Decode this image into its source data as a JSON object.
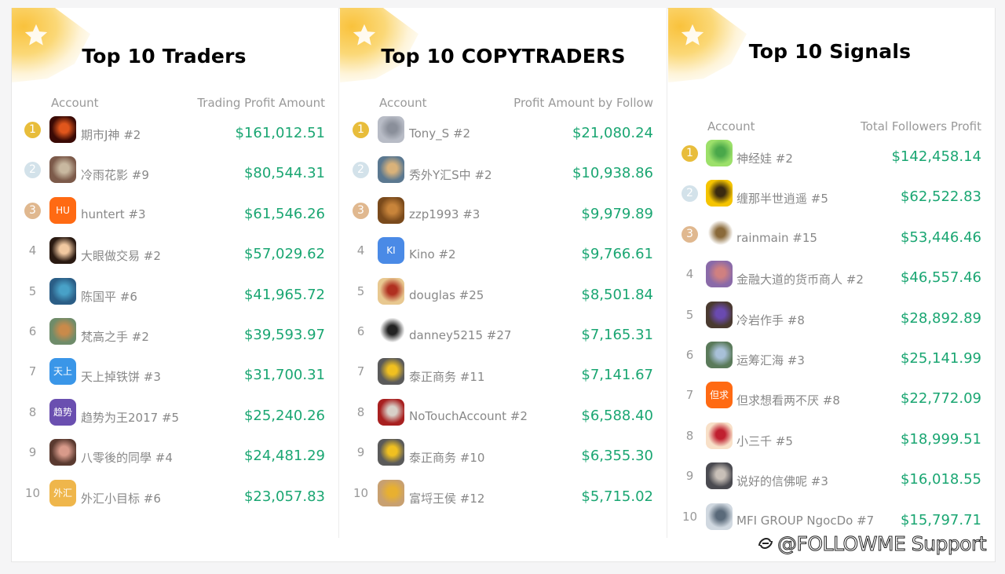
{
  "panels": [
    {
      "title": "Top 10 Traders",
      "col_account": "Account",
      "col_value": "Trading Profit Amount",
      "rows": [
        {
          "rank": "1",
          "account": "期市J神 #2",
          "amount": "$161,012.51",
          "avatar": {
            "type": "photo",
            "bg": "#3a0a05",
            "accent": "#e0561c",
            "label": ""
          }
        },
        {
          "rank": "2",
          "account": "冷雨花影 #9",
          "amount": "$80,544.31",
          "avatar": {
            "type": "photo",
            "bg": "#7c5a4a",
            "accent": "#c8b8a0",
            "label": ""
          }
        },
        {
          "rank": "3",
          "account": "huntert #3",
          "amount": "$61,546.26",
          "avatar": {
            "type": "initials",
            "bg": "#ff6a13",
            "label": "HU"
          }
        },
        {
          "rank": "4",
          "account": "大眼做交易 #2",
          "amount": "$57,029.62",
          "avatar": {
            "type": "photo",
            "bg": "#2a1a12",
            "accent": "#f1c8a0",
            "label": ""
          }
        },
        {
          "rank": "5",
          "account": "陈国平 #6",
          "amount": "$41,965.72",
          "avatar": {
            "type": "photo",
            "bg": "#2b5e86",
            "accent": "#48a1c7",
            "label": ""
          }
        },
        {
          "rank": "6",
          "account": "梵高之手 #2",
          "amount": "$39,593.97",
          "avatar": {
            "type": "photo",
            "bg": "#6f8c6a",
            "accent": "#c98a4a",
            "label": ""
          }
        },
        {
          "rank": "7",
          "account": "天上掉铁饼 #3",
          "amount": "$31,700.31",
          "avatar": {
            "type": "initials",
            "bg": "#3a96e8",
            "label": "天上"
          }
        },
        {
          "rank": "8",
          "account": "趋势为王2017 #5",
          "amount": "$25,240.26",
          "avatar": {
            "type": "initials",
            "bg": "#6a4fb0",
            "label": "趋势"
          }
        },
        {
          "rank": "9",
          "account": "八零後的同學 #4",
          "amount": "$24,481.29",
          "avatar": {
            "type": "photo",
            "bg": "#5a3a30",
            "accent": "#d89a8a",
            "label": ""
          }
        },
        {
          "rank": "10",
          "account": "外汇小目标 #6",
          "amount": "$23,057.83",
          "avatar": {
            "type": "initials",
            "bg": "#efb64b",
            "label": "外汇"
          }
        }
      ]
    },
    {
      "title": "Top 10 COPYTRADERS",
      "col_account": "Account",
      "col_value": "Profit Amount by Follow",
      "rows": [
        {
          "rank": "1",
          "account": "Tony_S #2",
          "amount": "$21,080.24",
          "avatar": {
            "type": "photo",
            "bg": "#b8bcc6",
            "accent": "#8a8f9a",
            "label": ""
          }
        },
        {
          "rank": "2",
          "account": "秀外Y汇S中 #2",
          "amount": "$10,938.86",
          "avatar": {
            "type": "photo",
            "bg": "#5b7890",
            "accent": "#d9b27a",
            "label": ""
          }
        },
        {
          "rank": "3",
          "account": "zzp1993 #3",
          "amount": "$9,979.89",
          "avatar": {
            "type": "photo",
            "bg": "#7a4a1c",
            "accent": "#c8843a",
            "label": ""
          }
        },
        {
          "rank": "4",
          "account": "Kino #2",
          "amount": "$9,766.61",
          "avatar": {
            "type": "initials",
            "bg": "#4a8ae6",
            "label": "KI"
          }
        },
        {
          "rank": "5",
          "account": "douglas #25",
          "amount": "$8,501.84",
          "avatar": {
            "type": "photo",
            "bg": "#e8c890",
            "accent": "#b03020",
            "label": ""
          }
        },
        {
          "rank": "6",
          "account": "danney5215 #27",
          "amount": "$7,165.31",
          "avatar": {
            "type": "photo",
            "bg": "#ffffff",
            "accent": "#222222",
            "label": ""
          }
        },
        {
          "rank": "7",
          "account": "泰正商务 #11",
          "amount": "$7,141.67",
          "avatar": {
            "type": "photo",
            "bg": "#5a5a5a",
            "accent": "#f0c020",
            "label": ""
          }
        },
        {
          "rank": "8",
          "account": "NoTouchAccount #2",
          "amount": "$6,588.40",
          "avatar": {
            "type": "photo",
            "bg": "#a82020",
            "accent": "#d8d0c8",
            "label": ""
          }
        },
        {
          "rank": "9",
          "account": "泰正商务 #10",
          "amount": "$6,355.30",
          "avatar": {
            "type": "photo",
            "bg": "#5a5a5a",
            "accent": "#f0c020",
            "label": ""
          }
        },
        {
          "rank": "10",
          "account": "富埒王侯 #12",
          "amount": "$5,715.02",
          "avatar": {
            "type": "photo",
            "bg": "#c8a070",
            "accent": "#e8b030",
            "label": ""
          }
        }
      ]
    },
    {
      "title": "Top 10 Signals",
      "col_account": "Account",
      "col_value": "Total Followers Profit",
      "rows": [
        {
          "rank": "1",
          "account": "神经娃 #2",
          "amount": "$142,458.14",
          "avatar": {
            "type": "photo",
            "bg": "#9ce06a",
            "accent": "#4aa84a",
            "label": ""
          }
        },
        {
          "rank": "2",
          "account": "缠那半世逍遥 #5",
          "amount": "$62,522.83",
          "avatar": {
            "type": "photo",
            "bg": "#f5c400",
            "accent": "#3a2a10",
            "label": ""
          }
        },
        {
          "rank": "3",
          "account": "rainmain #15",
          "amount": "$53,446.46",
          "avatar": {
            "type": "photo",
            "bg": "#ffffff",
            "accent": "#8a6a3a",
            "label": ""
          }
        },
        {
          "rank": "4",
          "account": "金融大道的货币商人 #2",
          "amount": "$46,557.46",
          "avatar": {
            "type": "photo",
            "bg": "#8a6aa8",
            "accent": "#d08080",
            "label": ""
          }
        },
        {
          "rank": "5",
          "account": "冷岩作手 #8",
          "amount": "$28,892.89",
          "avatar": {
            "type": "photo",
            "bg": "#4a3a30",
            "accent": "#6a4ab0",
            "label": ""
          }
        },
        {
          "rank": "6",
          "account": "运筹汇海 #3",
          "amount": "$25,141.99",
          "avatar": {
            "type": "photo",
            "bg": "#5a7a5a",
            "accent": "#a8c0d8",
            "label": ""
          }
        },
        {
          "rank": "7",
          "account": "但求想看两不厌 #8",
          "amount": "$22,772.09",
          "avatar": {
            "type": "initials",
            "bg": "#ff6a13",
            "label": "但求"
          }
        },
        {
          "rank": "8",
          "account": "小三千 #5",
          "amount": "$18,999.51",
          "avatar": {
            "type": "photo",
            "bg": "#f8e0c8",
            "accent": "#c02030",
            "label": ""
          }
        },
        {
          "rank": "9",
          "account": "说好的信佛呢 #3",
          "amount": "$16,018.55",
          "avatar": {
            "type": "photo",
            "bg": "#4a4a50",
            "accent": "#c8c0b8",
            "label": ""
          }
        },
        {
          "rank": "10",
          "account": "MFI GROUP NgocDo #7",
          "amount": "$15,797.71",
          "avatar": {
            "type": "photo",
            "bg": "#d0d8e0",
            "accent": "#5a6a7a",
            "label": ""
          }
        }
      ]
    }
  ],
  "watermark": "@FOLLOWME Support",
  "colors": {
    "amount_green": "#1aa672",
    "rank1_gold": "#e8bd3b",
    "rank2_silver": "#d3e2ea",
    "rank3_bronze": "#e0b88f",
    "muted_text": "#888888"
  }
}
